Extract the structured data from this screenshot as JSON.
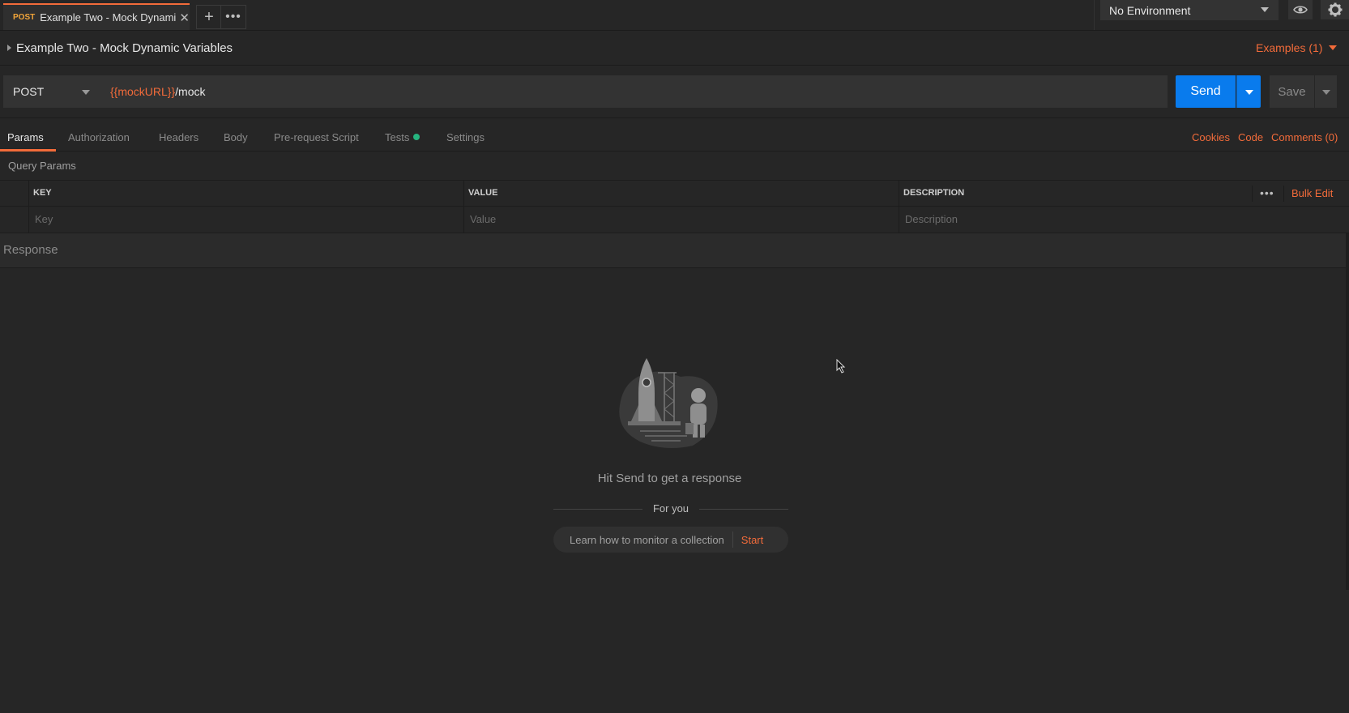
{
  "tab": {
    "method": "POST",
    "name": "Example Two - Mock Dynamic...",
    "close": "✕"
  },
  "tabbar": {
    "plus": "+",
    "more": "•••"
  },
  "environment": {
    "selected": "No Environment"
  },
  "request": {
    "name": "Example Two - Mock Dynamic Variables",
    "examples": "Examples (1)"
  },
  "url_bar": {
    "method": "POST",
    "url_variable": "{{mockURL}}",
    "url_path": "/mock",
    "send": "Send",
    "save": "Save"
  },
  "sub_tabs": [
    {
      "label": "Params"
    },
    {
      "label": "Authorization"
    },
    {
      "label": "Headers"
    },
    {
      "label": "Body"
    },
    {
      "label": "Pre-request Script"
    },
    {
      "label": "Tests"
    },
    {
      "label": "Settings"
    }
  ],
  "right_links": {
    "cookies": "Cookies",
    "code": "Code",
    "comments": "Comments (0)"
  },
  "query_params": {
    "label": "Query Params",
    "columns": [
      "KEY",
      "VALUE",
      "DESCRIPTION"
    ],
    "placeholders": [
      "Key",
      "Value",
      "Description"
    ],
    "more": "•••",
    "bulk_edit": "Bulk Edit"
  },
  "response": {
    "label": "Response",
    "hint": "Hit Send to get a response",
    "for_you": "For you",
    "learn": "Learn how to monitor a collection",
    "start": "Start"
  },
  "colors": {
    "accent": "#f26b3a",
    "send_blue": "#097bed",
    "tests_dot": "#26b47f",
    "bg": "#262626"
  }
}
